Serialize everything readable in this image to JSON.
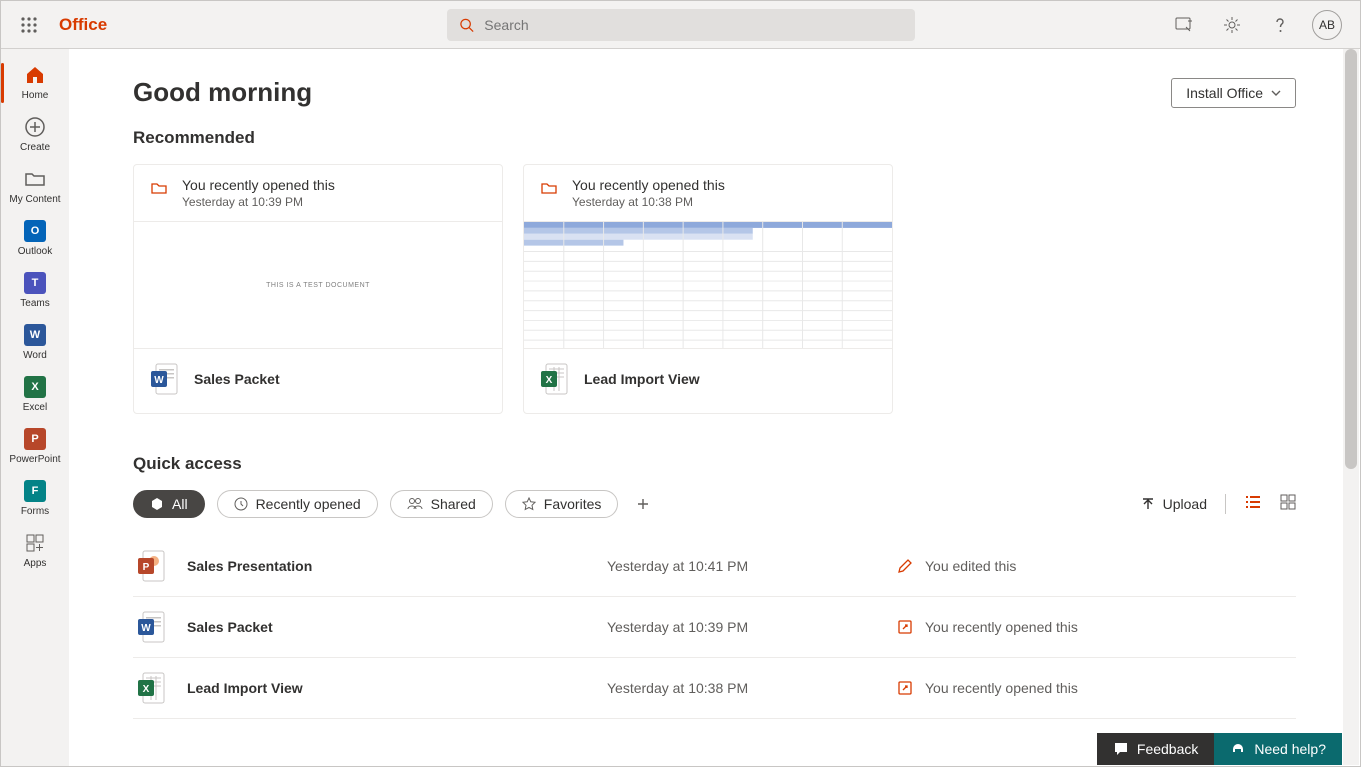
{
  "brand": "Office",
  "search": {
    "placeholder": "Search"
  },
  "avatar": "AB",
  "greeting": "Good morning",
  "install_label": "Install Office",
  "section_recommended": "Recommended",
  "section_quickaccess": "Quick access",
  "upload_label": "Upload",
  "feedback_label": "Feedback",
  "needhelp_label": "Need help?",
  "rail": [
    {
      "label": "Home"
    },
    {
      "label": "Create"
    },
    {
      "label": "My Content"
    },
    {
      "label": "Outlook"
    },
    {
      "label": "Teams"
    },
    {
      "label": "Word"
    },
    {
      "label": "Excel"
    },
    {
      "label": "PowerPoint"
    },
    {
      "label": "Forms"
    },
    {
      "label": "Apps"
    }
  ],
  "cards": [
    {
      "reason": "You recently opened this",
      "time": "Yesterday at 10:39 PM",
      "name": "Sales Packet",
      "preview_text": "THIS IS A TEST DOCUMENT",
      "type": "word"
    },
    {
      "reason": "You recently opened this",
      "time": "Yesterday at 10:38 PM",
      "name": "Lead Import View",
      "preview_text": "",
      "type": "excel"
    }
  ],
  "filters": [
    {
      "label": "All"
    },
    {
      "label": "Recently opened"
    },
    {
      "label": "Shared"
    },
    {
      "label": "Favorites"
    }
  ],
  "files": [
    {
      "name": "Sales Presentation",
      "time": "Yesterday at 10:41 PM",
      "activity": "You edited this",
      "type": "powerpoint",
      "act_icon": "pencil"
    },
    {
      "name": "Sales Packet",
      "time": "Yesterday at 10:39 PM",
      "activity": "You recently opened this",
      "type": "word",
      "act_icon": "open"
    },
    {
      "name": "Lead Import View",
      "time": "Yesterday at 10:38 PM",
      "activity": "You recently opened this",
      "type": "excel",
      "act_icon": "open"
    }
  ],
  "colors": {
    "orange": "#d83b01",
    "word": "#2b579a",
    "excel": "#217346",
    "powerpoint": "#b7472a",
    "outlook": "#0364b8",
    "teams": "#4b53bc",
    "forms": "#038387"
  }
}
